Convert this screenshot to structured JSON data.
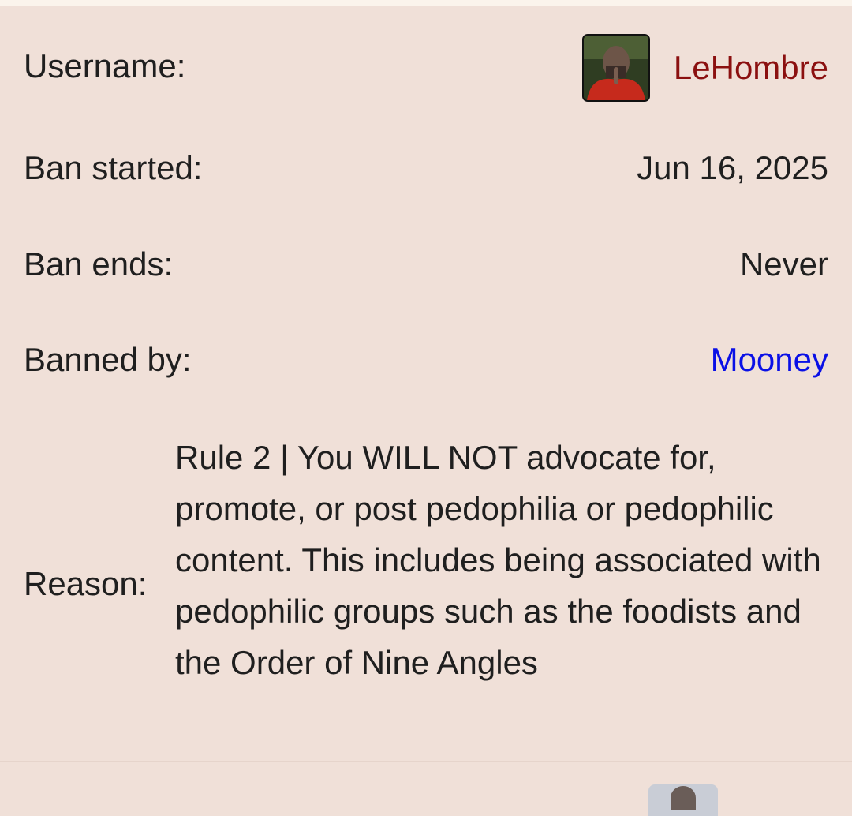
{
  "ban_entry": {
    "username_label": "Username:",
    "username": "LeHombre",
    "avatar_icon": "user-avatar-photo",
    "ban_started_label": "Ban started:",
    "ban_started": "Jun 16, 2025",
    "ban_ends_label": "Ban ends:",
    "ban_ends": "Never",
    "banned_by_label": "Banned by:",
    "banned_by": "Mooney",
    "reason_label": "Reason:",
    "reason": "Rule 2 | You WILL NOT advocate for, promote, or post pedophilia or pedophilic content. This includes being associated with pedophilic groups such as the foodists and the Order of Nine Angles"
  },
  "colors": {
    "background": "#f0e0d8",
    "username_link": "#8b1010",
    "banned_by_link": "#0a10e6",
    "text": "#1f1f1f"
  }
}
